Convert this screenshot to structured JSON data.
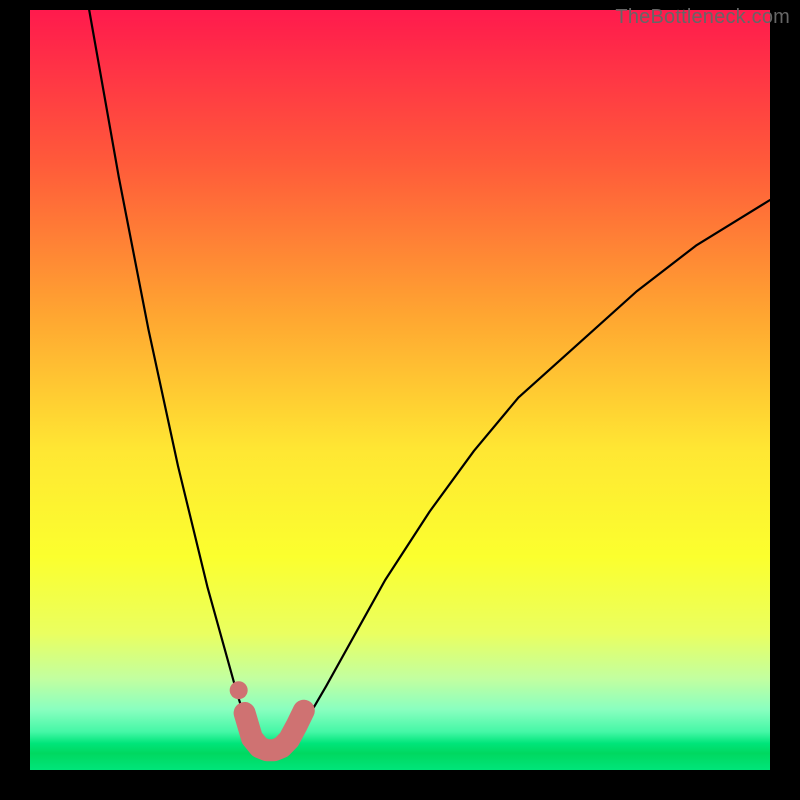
{
  "watermark": {
    "text": "TheBottleneck.com"
  },
  "chart_data": {
    "type": "line",
    "title": "",
    "xlabel": "",
    "ylabel": "",
    "xlim": [
      0,
      100
    ],
    "ylim": [
      0,
      100
    ],
    "series": [
      {
        "name": "bottleneck-curve",
        "color": "#000000",
        "x": [
          8,
          10,
          12,
          14,
          16,
          18,
          20,
          22,
          24,
          26,
          28,
          29.5,
          30.5,
          32,
          33.5,
          35,
          37,
          40,
          44,
          48,
          54,
          60,
          66,
          74,
          82,
          90,
          100
        ],
        "values": [
          100,
          89,
          78,
          68,
          58,
          49,
          40,
          32,
          24,
          17,
          10,
          5.5,
          3.0,
          2.2,
          2.2,
          3.0,
          6,
          11,
          18,
          25,
          34,
          42,
          49,
          56,
          63,
          69,
          75
        ]
      },
      {
        "name": "marker-band",
        "color": "#cf7272",
        "x": [
          29,
          30,
          31,
          32,
          33,
          34,
          35,
          36,
          37
        ],
        "values": [
          7.5,
          4.2,
          3.0,
          2.6,
          2.6,
          3.0,
          4.0,
          5.8,
          7.8
        ]
      },
      {
        "name": "marker-dot",
        "color": "#cf7272",
        "x": [
          28.2
        ],
        "values": [
          10.5
        ]
      }
    ],
    "background_gradient": {
      "stops": [
        {
          "pos": 0.0,
          "color": "#ff1a4d"
        },
        {
          "pos": 0.2,
          "color": "#ff5a3a"
        },
        {
          "pos": 0.4,
          "color": "#ffa531"
        },
        {
          "pos": 0.58,
          "color": "#ffe733"
        },
        {
          "pos": 0.72,
          "color": "#fbff2e"
        },
        {
          "pos": 0.82,
          "color": "#eaff60"
        },
        {
          "pos": 0.88,
          "color": "#c2ffa0"
        },
        {
          "pos": 0.92,
          "color": "#8affc0"
        },
        {
          "pos": 0.95,
          "color": "#44f7a6"
        },
        {
          "pos": 0.965,
          "color": "#00e57a"
        },
        {
          "pos": 0.978,
          "color": "#00d860"
        },
        {
          "pos": 1.0,
          "color": "#00e57a"
        }
      ]
    }
  }
}
